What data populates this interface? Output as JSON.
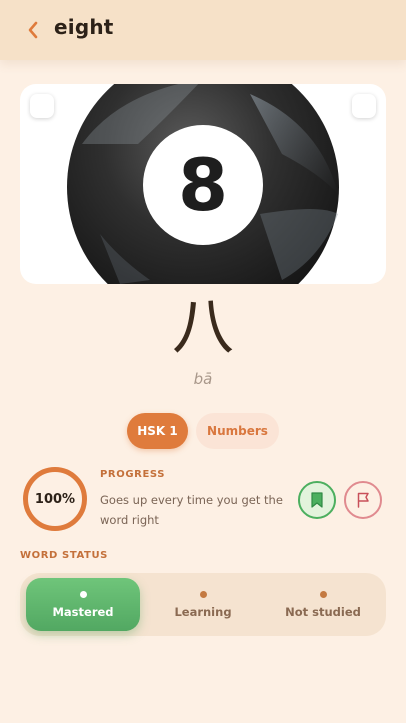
{
  "header": {
    "back_icon": "chevron-left-icon",
    "title": "eight"
  },
  "image": {
    "ball_number": "8"
  },
  "word": {
    "hanzi": "八",
    "pinyin": "bā"
  },
  "tags": {
    "level": "HSK 1",
    "category": "Numbers"
  },
  "progress": {
    "label": "PROGRESS",
    "percent_text": "100%",
    "percent_value": 100,
    "description": "Goes up every time you get the word right"
  },
  "actions": {
    "bookmark_icon": "bookmark-icon",
    "flag_icon": "flag-icon"
  },
  "status": {
    "label": "WORD STATUS",
    "options": [
      "Mastered",
      "Learning",
      "Not studied"
    ],
    "selected": "Mastered"
  },
  "colors": {
    "accent": "#df7b3c",
    "background": "#fdf0e4",
    "header": "#f6e1c8",
    "mastered_green": "#5cb56c",
    "flag_red": "#e08a8f"
  }
}
